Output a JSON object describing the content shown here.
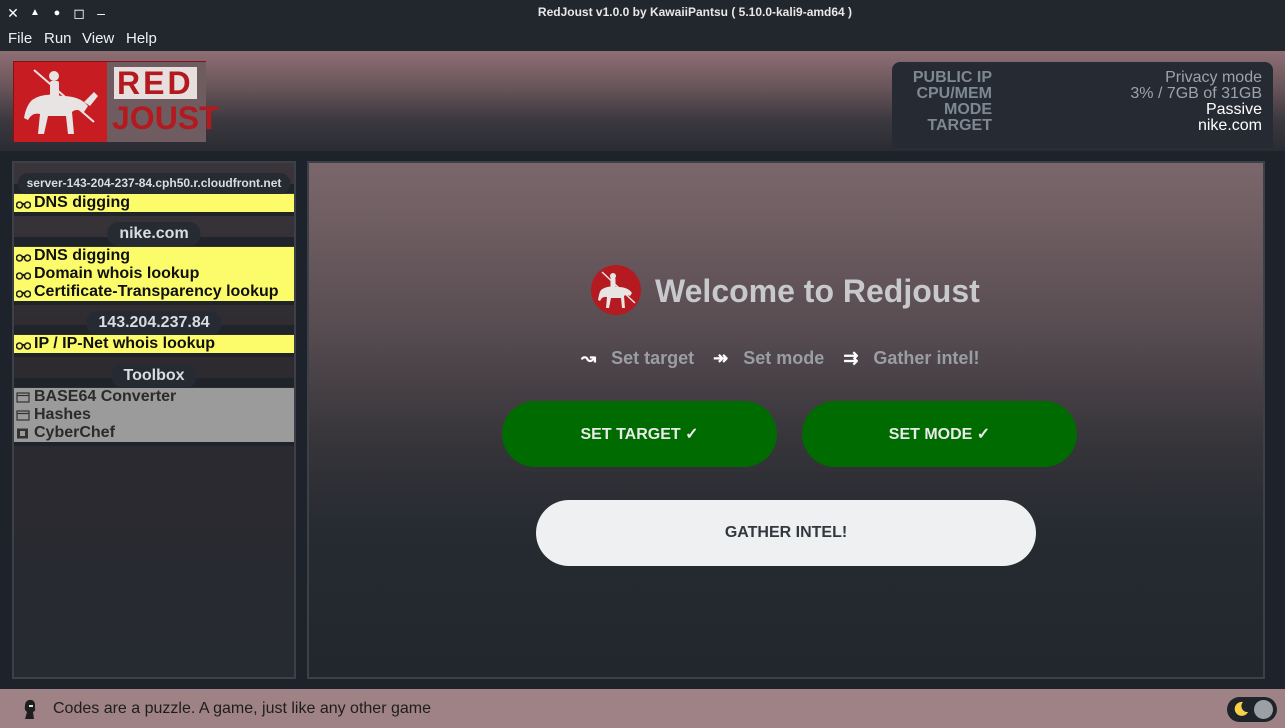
{
  "window": {
    "title": "RedJoust v1.0.0 by KawaiiPantsu ( 5.10.0-kali9-amd64 )",
    "controls": {
      "close": "✕",
      "up": "▲",
      "dot": "●",
      "maximize": "◻",
      "minimize": "–"
    }
  },
  "menu": [
    "File",
    "Run",
    "View",
    "Help"
  ],
  "logo": {
    "line1": "RED",
    "line2": "JOUST"
  },
  "info": {
    "labels": [
      "PUBLIC IP",
      "CPU/MEM",
      "MODE",
      "TARGET"
    ],
    "values": [
      "Privacy mode",
      "3% / 7GB of 31GB",
      "Passive",
      "nike.com"
    ]
  },
  "sidebar": {
    "groups": [
      {
        "title": "server-143-204-237-84.cph50.r.cloudfront.net",
        "items": [
          "DNS digging"
        ]
      },
      {
        "title": "nike.com",
        "items": [
          "DNS digging",
          "Domain whois lookup",
          "Certificate-Transparency lookup"
        ]
      },
      {
        "title": "143.204.237.84",
        "items": [
          "IP / IP-Net whois lookup"
        ]
      }
    ],
    "toolbox": {
      "title": "Toolbox",
      "items": [
        "BASE64 Converter",
        "Hashes",
        "CyberChef"
      ]
    }
  },
  "main": {
    "title": "Welcome to Redjoust",
    "steps": [
      {
        "arrow": "↝",
        "label": "Set target"
      },
      {
        "arrow": "↠",
        "label": "Set mode"
      },
      {
        "arrow": "⇉",
        "label": "Gather intel!"
      }
    ],
    "set_target_label": "SET TARGET ✓",
    "set_mode_label": "SET MODE ✓",
    "gather_label": "GATHER INTEL!"
  },
  "status": {
    "text": "Codes are a puzzle. A game, just like any other game"
  },
  "colors": {
    "accent_red": "#b41a1f",
    "done_green": "#006b00",
    "highlight_yellow": "#fcfc6a"
  }
}
